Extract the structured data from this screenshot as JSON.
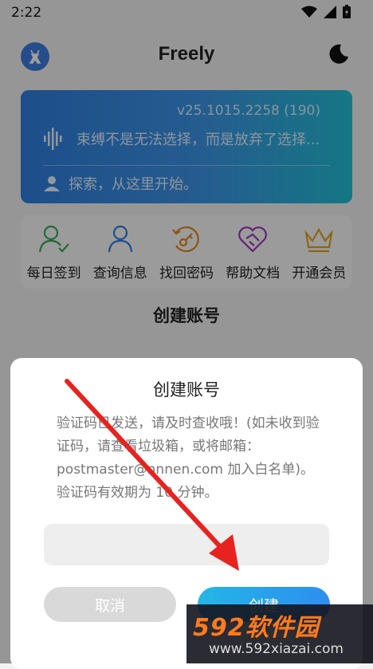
{
  "status_bar": {
    "time": "2:22"
  },
  "app_bar": {
    "title": "Freely"
  },
  "banner": {
    "version": "v25.1015.2258 (190)",
    "quote": "束缚不是无法选择，而是放弃了选择...",
    "explore": "探索，从这里开始。"
  },
  "features": [
    {
      "label": "每日签到",
      "icon": "user-check-icon",
      "color": "#3aa85a"
    },
    {
      "label": "查询信息",
      "icon": "user-icon",
      "color": "#2f7fe0"
    },
    {
      "label": "找回密码",
      "icon": "key-refresh-icon",
      "color": "#e08a1e"
    },
    {
      "label": "帮助文档",
      "icon": "heart-handshake-icon",
      "color": "#9b3bb5"
    },
    {
      "label": "开通会员",
      "icon": "crown-icon",
      "color": "#e0a51e"
    }
  ],
  "section_title": "创建账号",
  "dialog": {
    "title": "创建账号",
    "message": "验证码已发送，请及时查收哦！(如未收到验证码，请查看垃圾箱，或将邮箱：postmaster@nnnen.com 加入白名单)。验证码有效期为 10 分钟。",
    "input_value": "",
    "cancel_label": "取消",
    "confirm_label": "创建"
  },
  "watermark": {
    "brand": "592软件园",
    "url": "www.592xiazai.com"
  },
  "colors": {
    "primary": "#2f7fe0",
    "accent": "#22c0d6",
    "arrow": "#e8221e"
  }
}
